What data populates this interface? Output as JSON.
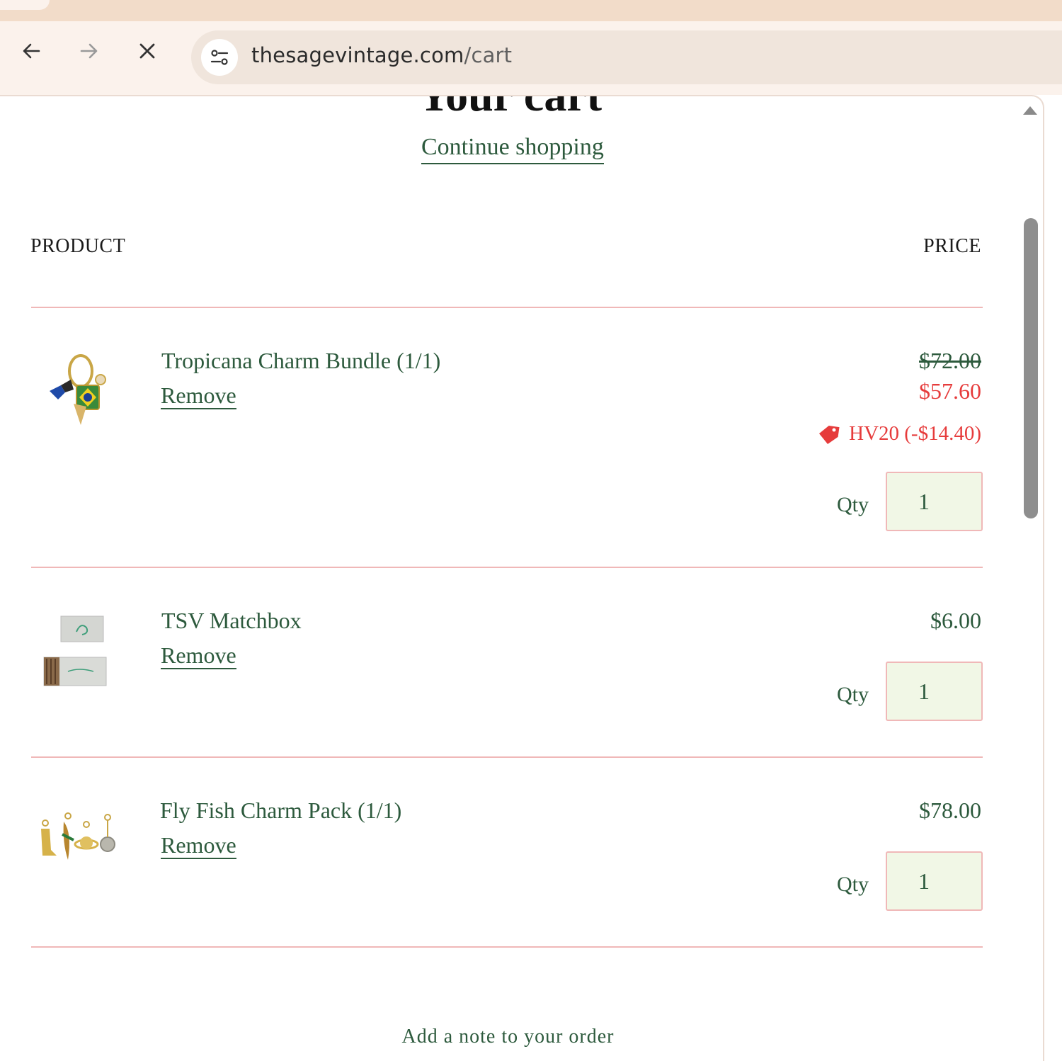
{
  "browser": {
    "url_host": "thesagevintage.com",
    "url_path": "/cart"
  },
  "page": {
    "title": "Your cart",
    "continue_shopping": "Continue shopping",
    "columns": {
      "product": "PRODUCT",
      "price": "PRICE"
    },
    "note_link": "Add a note to your order"
  },
  "cart": {
    "qty_label": "Qty",
    "remove_label": "Remove",
    "items": [
      {
        "name": "Tropicana Charm Bundle (1/1)",
        "original_price": "$72.00",
        "price": "$57.60",
        "discount": "HV20 (-$14.40)",
        "quantity": "1"
      },
      {
        "name": "TSV Matchbox",
        "price": "$6.00",
        "quantity": "1"
      },
      {
        "name": "Fly Fish Charm Pack (1/1)",
        "price": "$78.00",
        "quantity": "1"
      }
    ]
  },
  "colors": {
    "brand_green": "#2d5a3d",
    "sale_red": "#e63c3c",
    "divider_pink": "#f0b8b8",
    "qty_bg": "#f1f7e6"
  }
}
